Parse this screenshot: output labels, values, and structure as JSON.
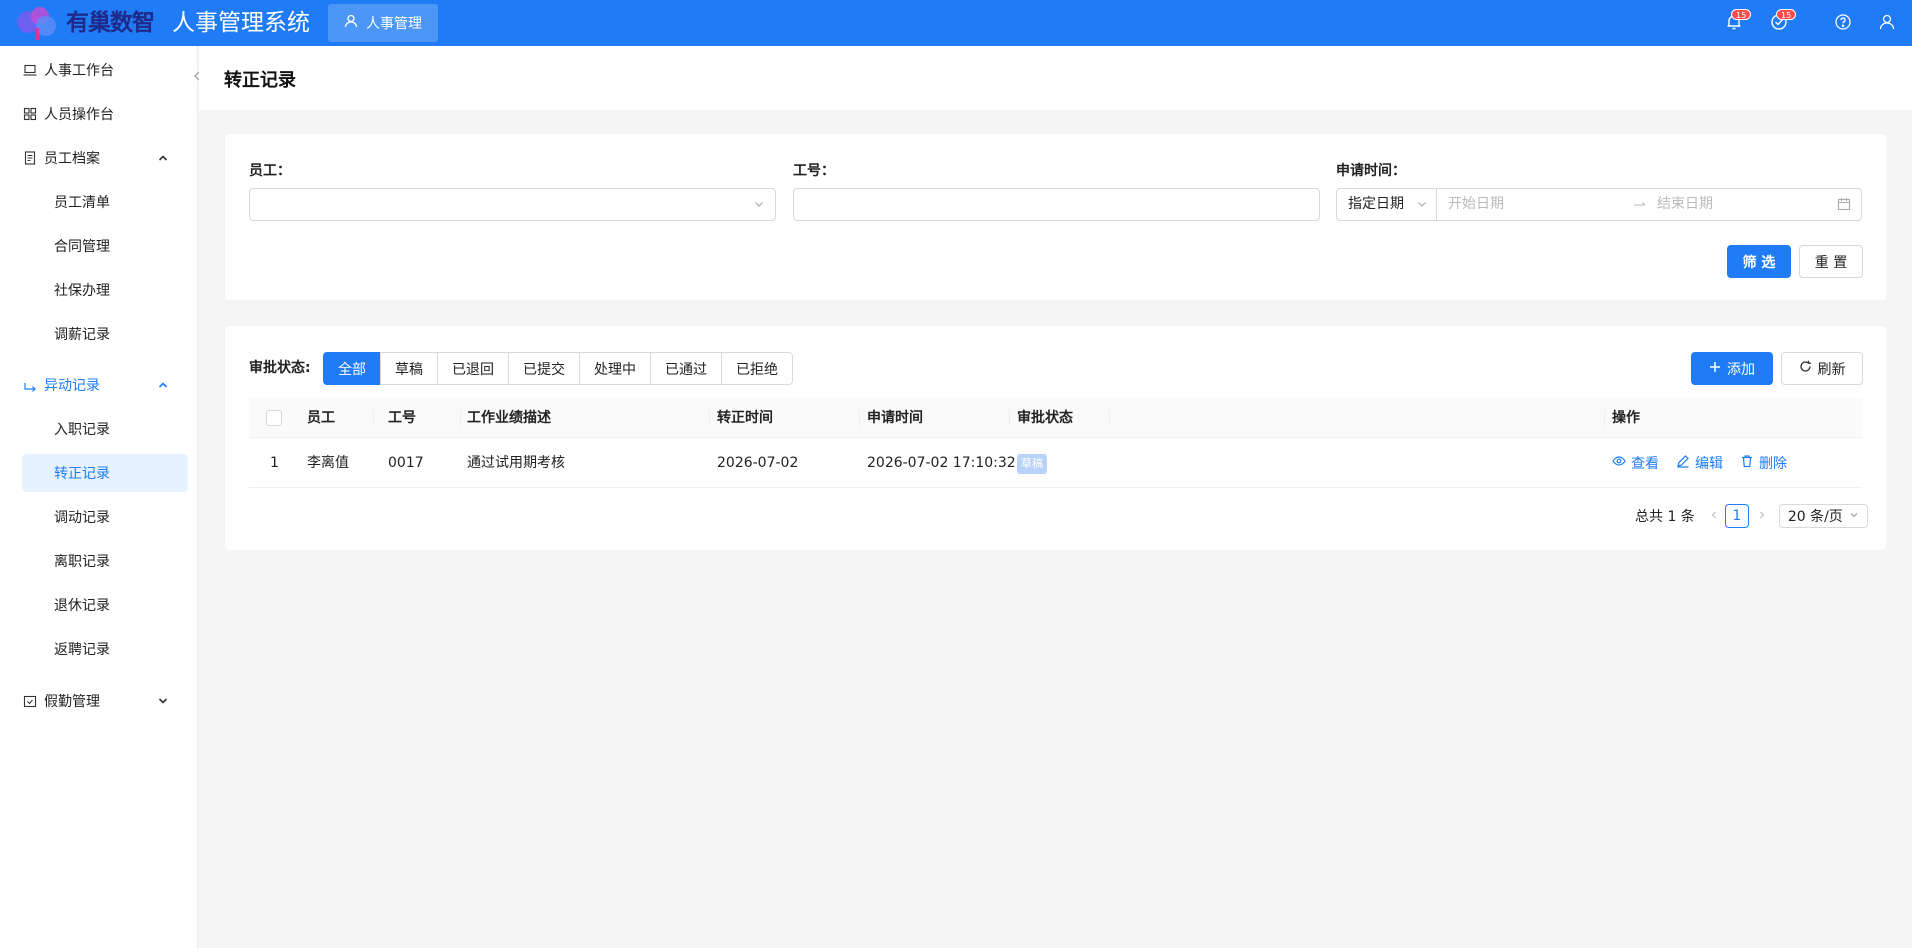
{
  "header": {
    "logo_text": "有巢数智",
    "app_title": "人事管理系统",
    "module_tab": "人事管理",
    "notification_count": "15",
    "task_count": "15"
  },
  "sidebar": {
    "items": [
      {
        "label": "人事工作台",
        "icon": "laptop-icon"
      },
      {
        "label": "人员操作台",
        "icon": "grid-icon"
      },
      {
        "label": "员工档案",
        "icon": "file-icon",
        "expanded": true
      },
      {
        "label": "员工清单"
      },
      {
        "label": "合同管理"
      },
      {
        "label": "社保办理"
      },
      {
        "label": "调薪记录"
      },
      {
        "label": "异动记录",
        "icon": "transfer-icon",
        "expanded": true
      },
      {
        "label": "入职记录"
      },
      {
        "label": "转正记录",
        "active": true
      },
      {
        "label": "调动记录"
      },
      {
        "label": "离职记录"
      },
      {
        "label": "退休记录"
      },
      {
        "label": "返聘记录"
      },
      {
        "label": "假勤管理",
        "icon": "calendar-check-icon",
        "expanded": false
      }
    ]
  },
  "page": {
    "title": "转正记录"
  },
  "filters": {
    "employee_label": "员工：",
    "employee_value": "",
    "jobno_label": "工号：",
    "jobno_value": "",
    "apply_time_label": "申请时间：",
    "date_mode": "指定日期",
    "start_placeholder": "开始日期",
    "end_placeholder": "结束日期",
    "filter_button": "筛 选",
    "reset_button": "重 置"
  },
  "list": {
    "status_label": "审批状态:",
    "status_tabs": [
      "全部",
      "草稿",
      "已退回",
      "已提交",
      "处理中",
      "已通过",
      "已拒绝"
    ],
    "active_status": "全部",
    "add_button": "添加",
    "refresh_button": "刷新",
    "columns": [
      "员工",
      "工号",
      "工作业绩描述",
      "转正时间",
      "申请时间",
      "审批状态",
      "操作"
    ],
    "rows": [
      {
        "index": "1",
        "employee": "李离值",
        "job_no": "0017",
        "description": "通过试用期考核",
        "regular_date": "2026-07-02",
        "apply_time": "2026-07-02 17:10:32",
        "status": "草稿"
      }
    ],
    "actions": [
      "查看",
      "编辑",
      "删除"
    ],
    "pagination": {
      "total_text": "总共 1 条",
      "current_page": "1",
      "page_size": "20 条/页"
    }
  },
  "colors": {
    "primary": "#1f7cf6",
    "draft_tag": "#b8d3f7",
    "badge": "#ff4d4f"
  }
}
